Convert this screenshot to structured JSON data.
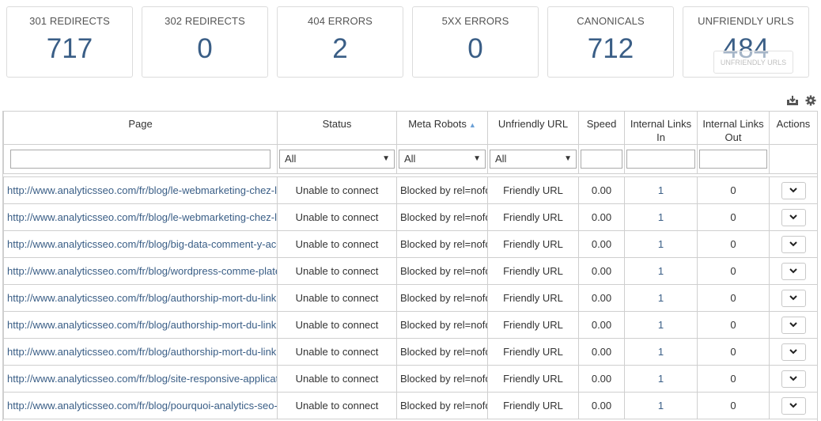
{
  "summary_cards": [
    {
      "label": "301 REDIRECTS",
      "value": "717"
    },
    {
      "label": "302 REDIRECTS",
      "value": "0"
    },
    {
      "label": "404 ERRORS",
      "value": "2"
    },
    {
      "label": "5XX ERRORS",
      "value": "0"
    },
    {
      "label": "CANONICALS",
      "value": "712"
    },
    {
      "label": "UNFRIENDLY URLS",
      "value": "484",
      "tooltip": "UNFRIENDLY URLS"
    }
  ],
  "toolbar": {
    "export_icon": "download-tray-icon",
    "settings_icon": "gear-icon"
  },
  "table": {
    "columns": {
      "page": "Page",
      "status": "Status",
      "meta_robots": "Meta Robots",
      "unfriendly_url": "Unfriendly URL",
      "speed": "Speed",
      "links_in": "Internal Links In",
      "links_out": "Internal Links Out",
      "actions": "Actions"
    },
    "filters": {
      "page_value": "",
      "status": "All",
      "meta_robots": "All",
      "unfriendly_url": "All",
      "speed_value": "",
      "links_in_value": "",
      "links_out_value": ""
    },
    "rows": [
      {
        "url": "http://www.analyticsseo.com/fr/blog/le-webmarketing-chez-le",
        "status": "Unable to connect",
        "meta": "Blocked by rel=nofollow",
        "unfriendly": "Friendly URL",
        "speed": "0.00",
        "links_in": "1",
        "links_out": "0"
      },
      {
        "url": "http://www.analyticsseo.com/fr/blog/le-webmarketing-chez-le",
        "status": "Unable to connect",
        "meta": "Blocked by rel=nofollow",
        "unfriendly": "Friendly URL",
        "speed": "0.00",
        "links_in": "1",
        "links_out": "0"
      },
      {
        "url": "http://www.analyticsseo.com/fr/blog/big-data-comment-y-acce",
        "status": "Unable to connect",
        "meta": "Blocked by rel=nofollow",
        "unfriendly": "Friendly URL",
        "speed": "0.00",
        "links_in": "1",
        "links_out": "0"
      },
      {
        "url": "http://www.analyticsseo.com/fr/blog/wordpress-comme-platef",
        "status": "Unable to connect",
        "meta": "Blocked by rel=nofollow",
        "unfriendly": "Friendly URL",
        "speed": "0.00",
        "links_in": "1",
        "links_out": "0"
      },
      {
        "url": "http://www.analyticsseo.com/fr/blog/authorship-mort-du-link",
        "status": "Unable to connect",
        "meta": "Blocked by rel=nofollow",
        "unfriendly": "Friendly URL",
        "speed": "0.00",
        "links_in": "1",
        "links_out": "0"
      },
      {
        "url": "http://www.analyticsseo.com/fr/blog/authorship-mort-du-link",
        "status": "Unable to connect",
        "meta": "Blocked by rel=nofollow",
        "unfriendly": "Friendly URL",
        "speed": "0.00",
        "links_in": "1",
        "links_out": "0"
      },
      {
        "url": "http://www.analyticsseo.com/fr/blog/authorship-mort-du-link",
        "status": "Unable to connect",
        "meta": "Blocked by rel=nofollow",
        "unfriendly": "Friendly URL",
        "speed": "0.00",
        "links_in": "1",
        "links_out": "0"
      },
      {
        "url": "http://www.analyticsseo.com/fr/blog/site-responsive-applicat",
        "status": "Unable to connect",
        "meta": "Blocked by rel=nofollow",
        "unfriendly": "Friendly URL",
        "speed": "0.00",
        "links_in": "1",
        "links_out": "0"
      },
      {
        "url": "http://www.analyticsseo.com/fr/blog/pourquoi-analytics-seo-",
        "status": "Unable to connect",
        "meta": "Blocked by rel=nofollow",
        "unfriendly": "Friendly URL",
        "speed": "0.00",
        "links_in": "1",
        "links_out": "0"
      }
    ]
  },
  "colors": {
    "accent": "#3a5e86",
    "border": "#cfcfcf",
    "sort_icon": "#6ba0d6"
  }
}
